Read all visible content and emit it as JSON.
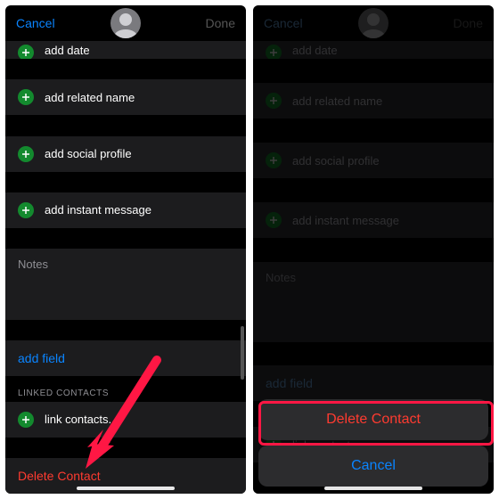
{
  "nav": {
    "cancel": "Cancel",
    "done": "Done"
  },
  "rows": {
    "partial": "add date",
    "related": "add related name",
    "social": "add social profile",
    "im": "add instant message",
    "notes": "Notes",
    "addfield": "add field",
    "linked_header": "LINKED CONTACTS",
    "link": "link contacts...",
    "delete": "Delete Contact"
  },
  "sheet": {
    "delete": "Delete Contact",
    "cancel": "Cancel"
  }
}
